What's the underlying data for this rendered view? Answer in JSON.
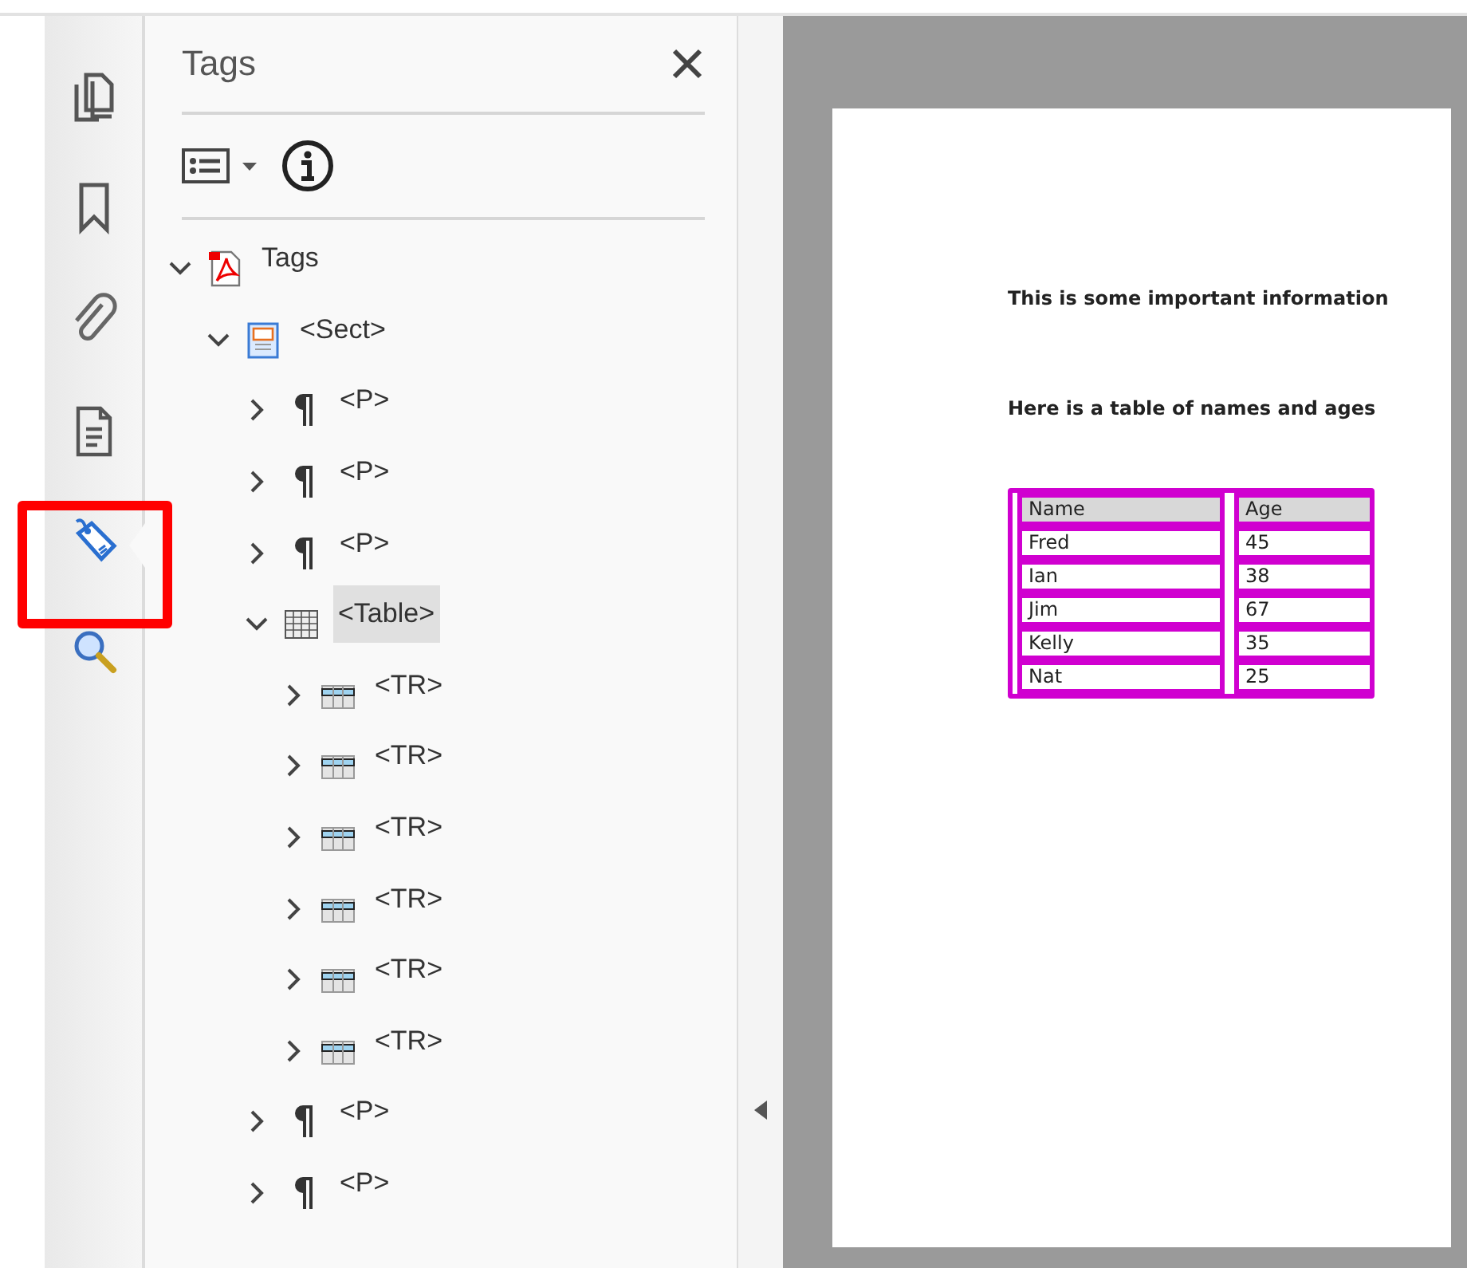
{
  "sidebar": {
    "items": [
      {
        "kind": "pages",
        "selected": false
      },
      {
        "kind": "bookmark",
        "selected": false
      },
      {
        "kind": "attachment",
        "selected": false
      },
      {
        "kind": "document",
        "selected": false
      },
      {
        "kind": "tag",
        "selected": true
      },
      {
        "kind": "search",
        "selected": false
      }
    ]
  },
  "panel": {
    "title": "Tags",
    "tree": [
      {
        "label": "Tags",
        "kind": "root",
        "expanded": true,
        "selected": false,
        "children": [
          {
            "label": "<Sect>",
            "kind": "sect",
            "expanded": true,
            "selected": false,
            "children": [
              {
                "label": "<P>",
                "kind": "p",
                "expanded": false,
                "selected": false
              },
              {
                "label": "<P>",
                "kind": "p",
                "expanded": false,
                "selected": false
              },
              {
                "label": "<P>",
                "kind": "p",
                "expanded": false,
                "selected": false
              },
              {
                "label": "<Table>",
                "kind": "table",
                "expanded": true,
                "selected": true,
                "children": [
                  {
                    "label": "<TR>",
                    "kind": "tr",
                    "expanded": false,
                    "selected": false
                  },
                  {
                    "label": "<TR>",
                    "kind": "tr",
                    "expanded": false,
                    "selected": false
                  },
                  {
                    "label": "<TR>",
                    "kind": "tr",
                    "expanded": false,
                    "selected": false
                  },
                  {
                    "label": "<TR>",
                    "kind": "tr",
                    "expanded": false,
                    "selected": false
                  },
                  {
                    "label": "<TR>",
                    "kind": "tr",
                    "expanded": false,
                    "selected": false
                  },
                  {
                    "label": "<TR>",
                    "kind": "tr",
                    "expanded": false,
                    "selected": false
                  }
                ]
              },
              {
                "label": "<P>",
                "kind": "p",
                "expanded": false,
                "selected": false
              },
              {
                "label": "<P>",
                "kind": "p",
                "expanded": false,
                "selected": false
              }
            ]
          }
        ]
      }
    ]
  },
  "document": {
    "paragraphs": [
      "This is some important information",
      "Here is a table of names and ages"
    ],
    "table": {
      "columns": [
        "Name",
        "Age"
      ],
      "rows": [
        [
          "Fred",
          "45"
        ],
        [
          "Ian",
          "38"
        ],
        [
          "Jim",
          "67"
        ],
        [
          "Kelly",
          "35"
        ],
        [
          "Nat",
          "25"
        ]
      ]
    }
  }
}
